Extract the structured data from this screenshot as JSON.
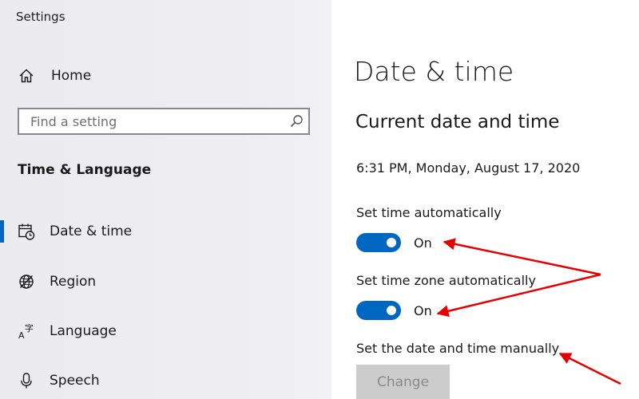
{
  "window": {
    "title": "Settings"
  },
  "sidebar": {
    "home_label": "Home",
    "search": {
      "placeholder": "Find a setting",
      "value": ""
    },
    "section_heading": "Time & Language",
    "items": [
      {
        "label": "Date & time",
        "icon": "calendar-clock-icon",
        "selected": true
      },
      {
        "label": "Region",
        "icon": "globe-icon",
        "selected": false
      },
      {
        "label": "Language",
        "icon": "language-icon",
        "selected": false
      },
      {
        "label": "Speech",
        "icon": "microphone-icon",
        "selected": false
      }
    ]
  },
  "main": {
    "page_title": "Date & time",
    "current_section_title": "Current date and time",
    "current_datetime": "6:31 PM, Monday, August 17, 2020",
    "set_time_automatically": {
      "label": "Set time automatically",
      "state": "On"
    },
    "set_timezone_automatically": {
      "label": "Set time zone automatically",
      "state": "On"
    },
    "manual": {
      "label": "Set the date and time manually",
      "button_label": "Change",
      "button_enabled": false
    }
  },
  "colors": {
    "accent": "#0067c0",
    "annotation_arrow": "#e60000",
    "sidebar_background": "#eeeef1",
    "disabled_button": "#cccccc"
  }
}
